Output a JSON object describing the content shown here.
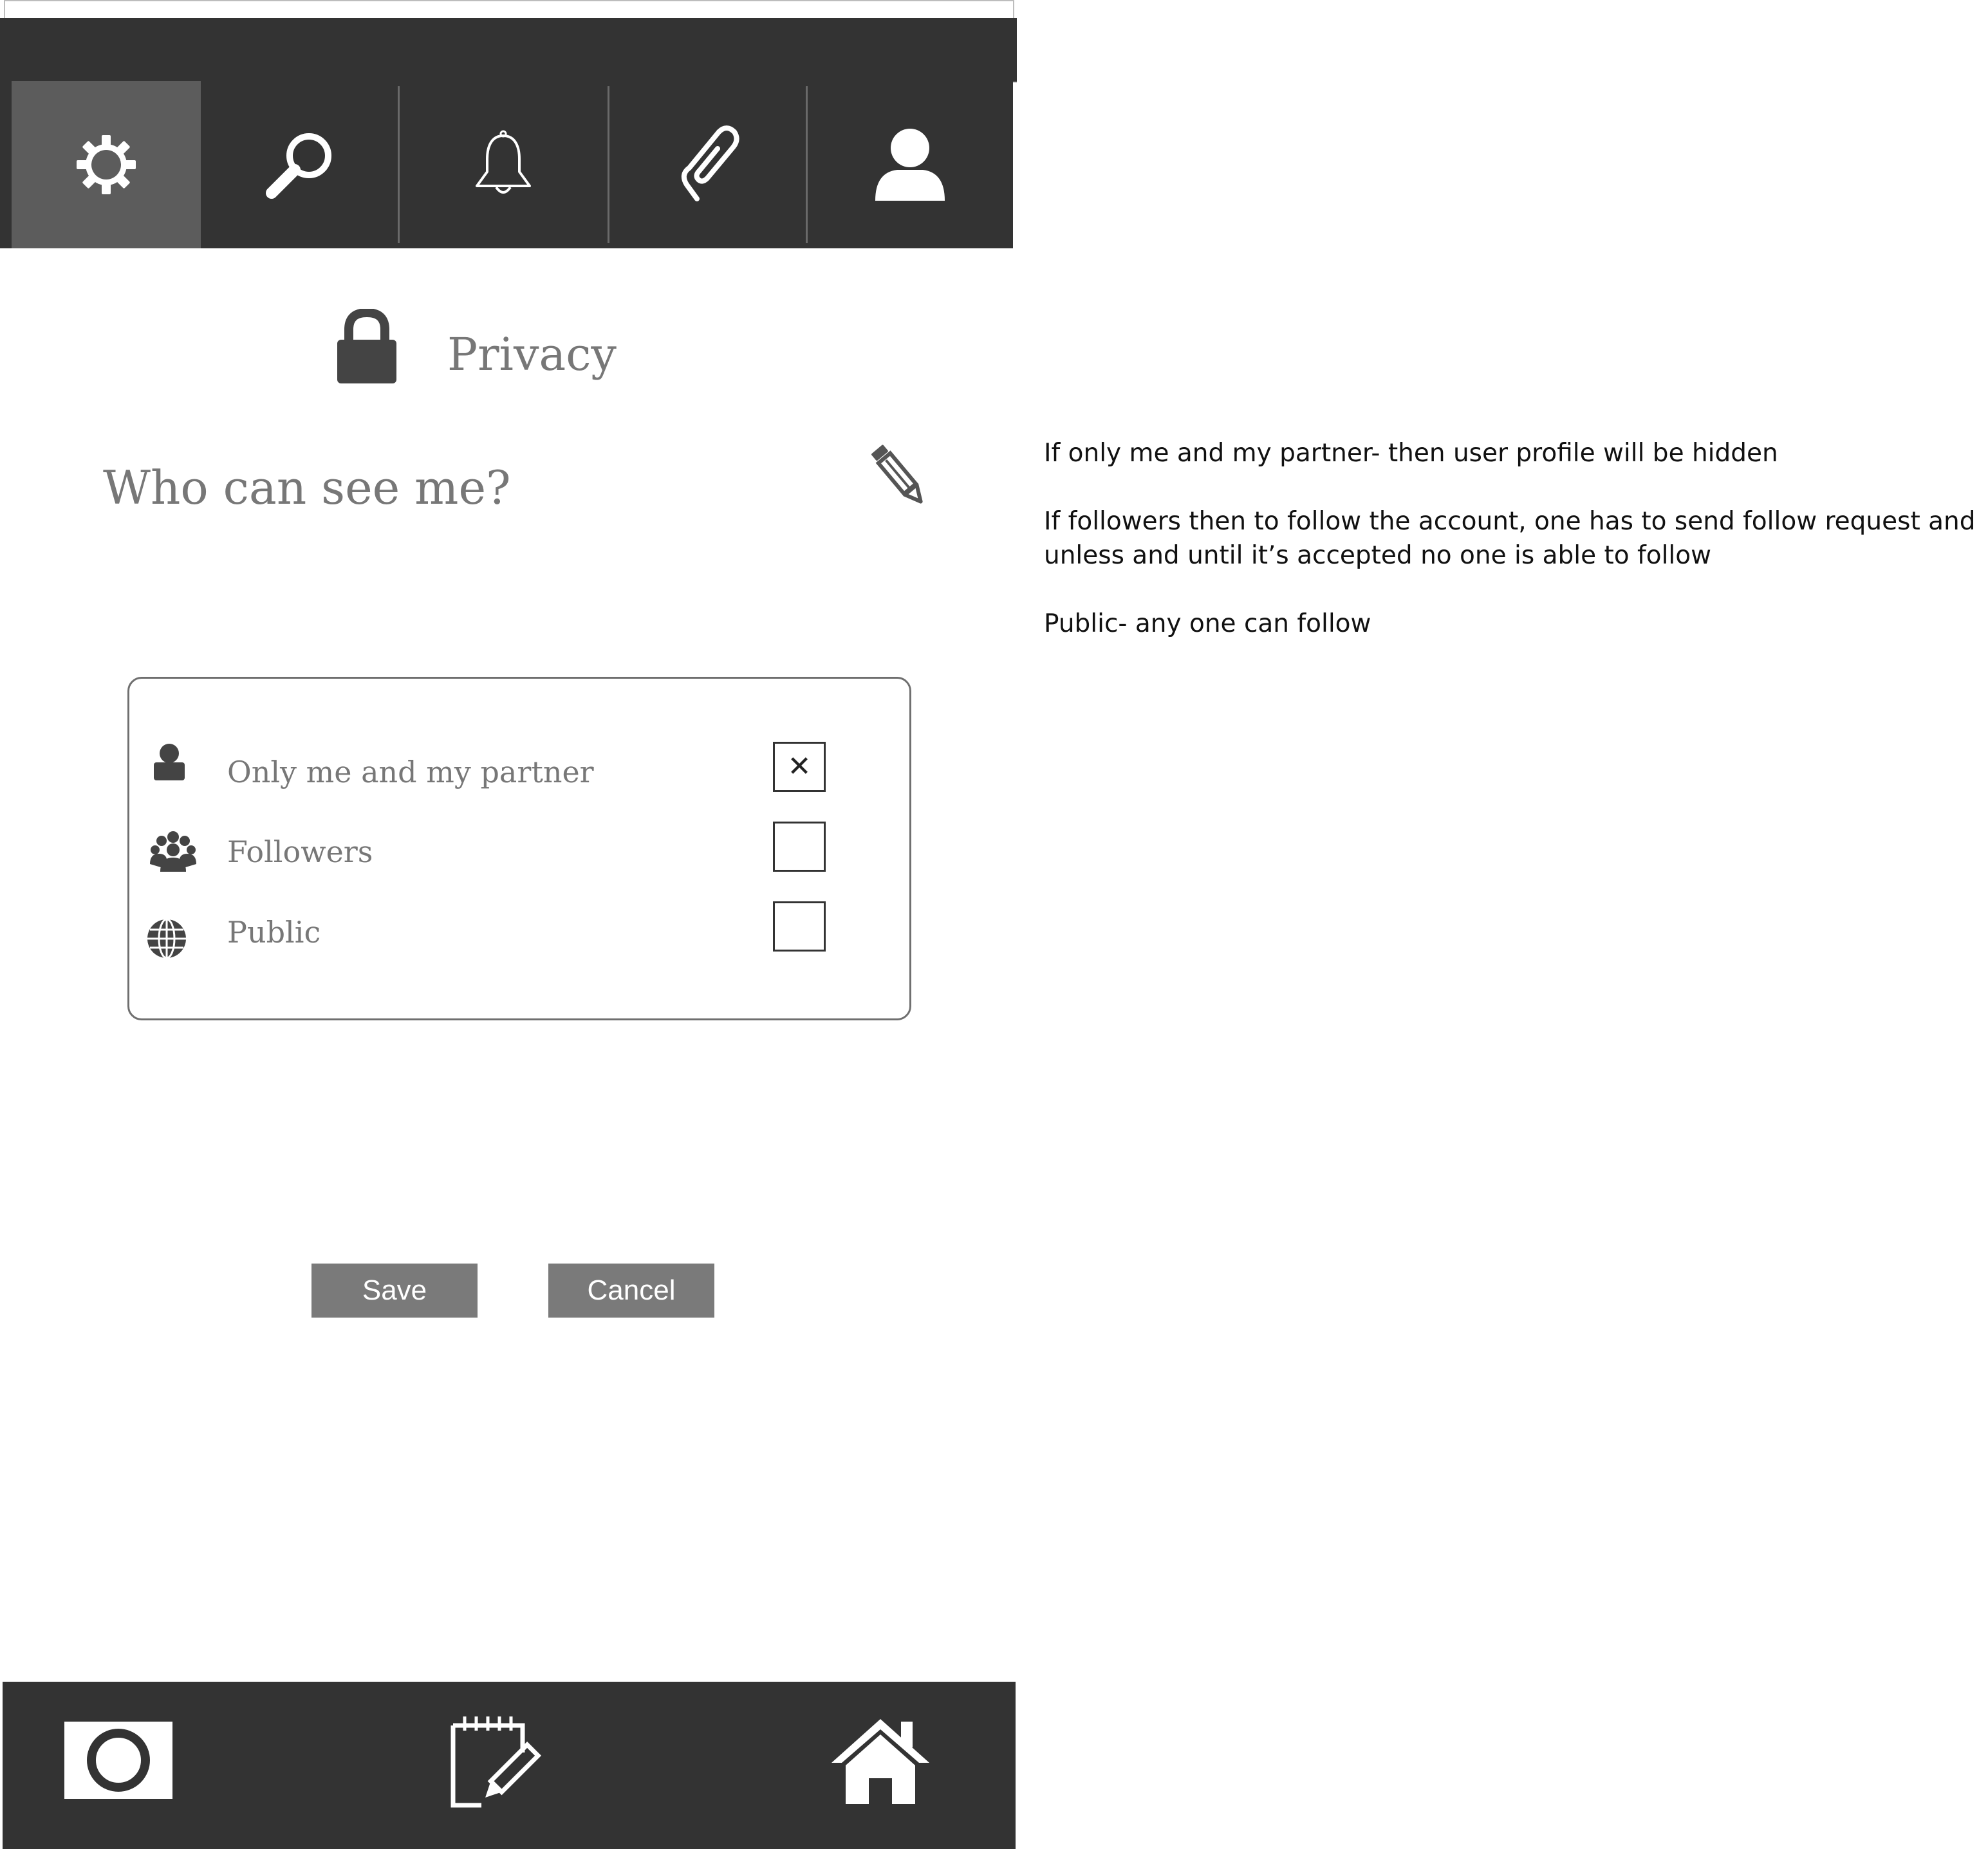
{
  "tabs": [
    {
      "name": "settings",
      "icon": "gear-icon",
      "active": true
    },
    {
      "name": "search",
      "icon": "search-icon",
      "active": false
    },
    {
      "name": "notifications",
      "icon": "bell-icon",
      "active": false
    },
    {
      "name": "attachments",
      "icon": "paperclip-icon",
      "active": false
    },
    {
      "name": "profile",
      "icon": "user-icon",
      "active": false
    }
  ],
  "header": {
    "title": "Privacy",
    "icon": "lock-icon"
  },
  "section": {
    "title": "Who can see me?",
    "edit_icon": "pencil-icon"
  },
  "options": [
    {
      "label": "Only me and my partner",
      "icon": "person-icon",
      "checked": true,
      "mark": "✕"
    },
    {
      "label": "Followers",
      "icon": "group-icon",
      "checked": false,
      "mark": ""
    },
    {
      "label": "Public",
      "icon": "globe-icon",
      "checked": false,
      "mark": ""
    }
  ],
  "buttons": {
    "save": "Save",
    "cancel": "Cancel"
  },
  "bottom_nav": [
    {
      "name": "camera",
      "icon": "camera-icon"
    },
    {
      "name": "notes",
      "icon": "notepad-edit-icon"
    },
    {
      "name": "home",
      "icon": "home-icon"
    }
  ],
  "notes": {
    "line1": "If only me and my partner- then user profile will be hidden",
    "line2": "If followers then to follow the account, one has to send follow request and unless and until it’s accepted no one is able to follow",
    "line3": "Public- any one can follow"
  },
  "colors": {
    "bar": "#333333",
    "active_tab": "#5c5c5c",
    "text_gray": "#777777",
    "button": "#7a7a7a"
  }
}
